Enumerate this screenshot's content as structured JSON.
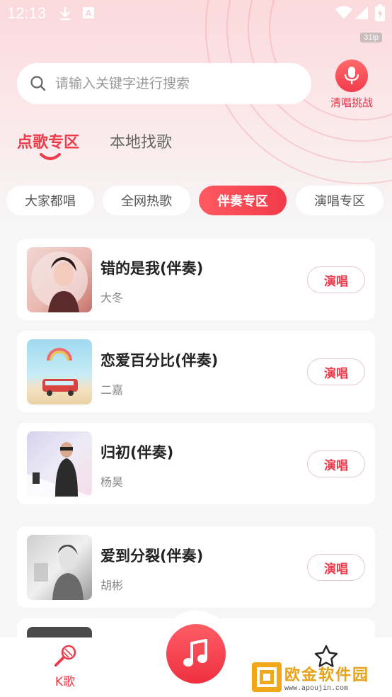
{
  "status_bar": {
    "time": "12:13",
    "tag": "31ip"
  },
  "search": {
    "placeholder": "请输入关键字进行搜索",
    "value": ""
  },
  "mic": {
    "label": "清唱挑战",
    "icon": "microphone-icon"
  },
  "main_tabs": [
    {
      "label": "点歌专区",
      "active": true
    },
    {
      "label": "本地找歌",
      "active": false
    }
  ],
  "chips": [
    {
      "label": "大家都唱",
      "active": false
    },
    {
      "label": "全网热歌",
      "active": false
    },
    {
      "label": "伴奏专区",
      "active": true
    },
    {
      "label": "演唱专区",
      "active": false
    }
  ],
  "songs": [
    {
      "title": "错的是我(伴奏)",
      "artist": "大冬",
      "action": "演唱"
    },
    {
      "title": "恋爱百分比(伴奏)",
      "artist": "二嘉",
      "action": "演唱"
    },
    {
      "title": "归初(伴奏)",
      "artist": "杨昊",
      "action": "演唱"
    },
    {
      "title": "爱到分裂(伴奏)",
      "artist": "胡彬",
      "action": "演唱"
    }
  ],
  "bottom_nav": {
    "k_label": "K歌",
    "center_icon": "music-note-icon",
    "right_icon": "star-icon"
  },
  "watermark": {
    "name": "欧金软件园",
    "url": "www.apoujin.com"
  },
  "colors": {
    "accent": "#ee3a4a",
    "chip_active": "#f23a4a",
    "background": "#f6f6f6"
  }
}
